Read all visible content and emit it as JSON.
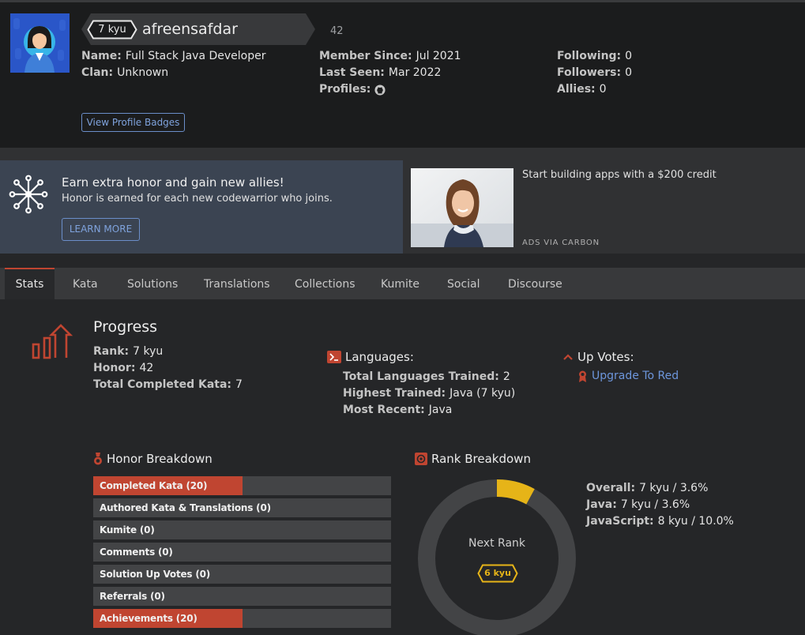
{
  "profile": {
    "rank": "7 kyu",
    "username": "afreensafdar",
    "honor": "42",
    "name_label": "Name:",
    "name_value": "Full Stack Java Developer",
    "clan_label": "Clan:",
    "clan_value": "Unknown",
    "member_since_label": "Member Since:",
    "member_since_value": "Jul 2021",
    "last_seen_label": "Last Seen:",
    "last_seen_value": "Mar 2022",
    "profiles_label": "Profiles:",
    "profiles_icon": "github-icon",
    "following_label": "Following:",
    "following_value": "0",
    "followers_label": "Followers:",
    "followers_value": "0",
    "allies_label": "Allies:",
    "allies_value": "0",
    "badges_button": "View Profile Badges"
  },
  "promo": {
    "title": "Earn extra honor and gain new allies!",
    "subtitle": "Honor is earned for each new codewarrior who joins.",
    "button": "LEARN MORE",
    "icon": "network-icon"
  },
  "ad": {
    "text": "Start building apps with a $200 credit",
    "via": "ADS VIA CARBON"
  },
  "tabs": [
    "Stats",
    "Kata",
    "Solutions",
    "Translations",
    "Collections",
    "Kumite",
    "Social",
    "Discourse"
  ],
  "active_tab": "Stats",
  "progress": {
    "title": "Progress",
    "rank_label": "Rank:",
    "rank_value": "7 kyu",
    "honor_label": "Honor:",
    "honor_value": "42",
    "completed_label": "Total Completed Kata:",
    "completed_value": "7"
  },
  "languages": {
    "title": "Languages:",
    "total_label": "Total Languages Trained:",
    "total_value": "2",
    "highest_label": "Highest Trained:",
    "highest_value": "Java (7 kyu)",
    "recent_label": "Most Recent:",
    "recent_value": "Java"
  },
  "upvotes": {
    "title": "Up Votes:",
    "link": "Upgrade To Red"
  },
  "honor_breakdown": {
    "title": "Honor Breakdown",
    "items": [
      {
        "label": "Completed Kata (20)",
        "fraction": 0.5
      },
      {
        "label": "Authored Kata & Translations (0)",
        "fraction": 0
      },
      {
        "label": "Kumite (0)",
        "fraction": 0
      },
      {
        "label": "Comments (0)",
        "fraction": 0
      },
      {
        "label": "Solution Up Votes (0)",
        "fraction": 0
      },
      {
        "label": "Referrals (0)",
        "fraction": 0
      },
      {
        "label": "Achievements (20)",
        "fraction": 0.5
      }
    ]
  },
  "rank_breakdown": {
    "title": "Rank Breakdown",
    "overall_label": "Overall:",
    "overall_value": "7 kyu / 3.6%",
    "java_label": "Java:",
    "java_value": "7 kyu / 3.6%",
    "js_label": "JavaScript:",
    "js_value": "8 kyu / 10.0%",
    "next_rank_label": "Next Rank",
    "next_rank_value": "6 kyu",
    "progress_fraction": 0.036
  },
  "colors": {
    "accent_red": "#c04531",
    "link_blue": "#6d96dc",
    "rank_yellow": "#e6b418"
  }
}
